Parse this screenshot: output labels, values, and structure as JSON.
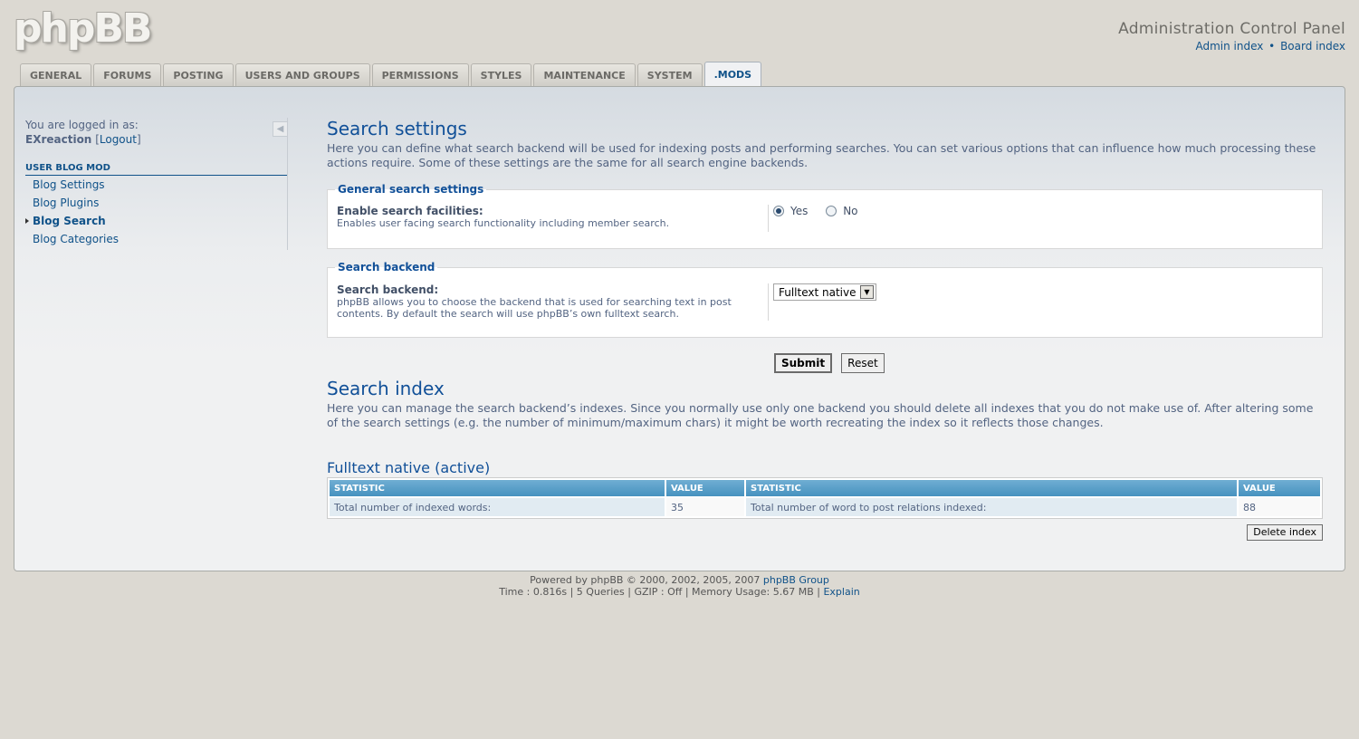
{
  "header": {
    "logo": "phpBB",
    "title": "Administration Control Panel",
    "links": [
      "Admin index",
      "Board index"
    ],
    "separator": "•"
  },
  "tabs": [
    {
      "label": "GENERAL",
      "active": false
    },
    {
      "label": "FORUMS",
      "active": false
    },
    {
      "label": "POSTING",
      "active": false
    },
    {
      "label": "USERS AND GROUPS",
      "active": false
    },
    {
      "label": "PERMISSIONS",
      "active": false
    },
    {
      "label": "STYLES",
      "active": false
    },
    {
      "label": "MAINTENANCE",
      "active": false
    },
    {
      "label": "SYSTEM",
      "active": false
    },
    {
      "label": ".MODS",
      "active": true
    }
  ],
  "sidebar": {
    "logged_in_label": "You are logged in as:",
    "username": "EXreaction",
    "logout_open": "[",
    "logout": "Logout",
    "logout_close": "]",
    "section_title": "USER BLOG MOD",
    "items": [
      {
        "label": "Blog Settings",
        "active": false
      },
      {
        "label": "Blog Plugins",
        "active": false
      },
      {
        "label": "Blog Search",
        "active": true
      },
      {
        "label": "Blog Categories",
        "active": false
      }
    ]
  },
  "main": {
    "settings_title": "Search settings",
    "settings_desc": "Here you can define what search backend will be used for indexing posts and performing searches. You can set various options that can influence how much processing these actions require. Some of these settings are the same for all search engine backends.",
    "general_legend": "General search settings",
    "enable_label": "Enable search facilities:",
    "enable_hint": "Enables user facing search functionality including member search.",
    "yes_label": "Yes",
    "no_label": "No",
    "enable_value": "Yes",
    "backend_legend": "Search backend",
    "backend_label": "Search backend:",
    "backend_hint": "phpBB allows you to choose the backend that is used for searching text in post contents. By default the search will use phpBB’s own fulltext search.",
    "backend_value": "Fulltext native",
    "submit": "Submit",
    "reset": "Reset",
    "index_title": "Search index",
    "index_desc": "Here you can manage the search backend’s indexes. Since you normally use only one backend you should delete all indexes that you do not make use of. After altering some of the search settings (e.g. the number of minimum/maximum chars) it might be worth recreating the index so it reflects those changes.",
    "native_title": "Fulltext native (active)",
    "table": {
      "headers": [
        "STATISTIC",
        "VALUE",
        "STATISTIC",
        "VALUE"
      ],
      "rows": [
        [
          "Total number of indexed words:",
          "35",
          "Total number of word to post relations indexed:",
          "88"
        ]
      ]
    },
    "delete_index": "Delete index"
  },
  "footer": {
    "powered": "Powered by phpBB © 2000, 2002, 2005, 2007",
    "group": "phpBB Group",
    "stats": "Time : 0.816s | 5 Queries | GZIP : Off | Memory Usage: 5.67 MB |",
    "explain": "Explain"
  }
}
